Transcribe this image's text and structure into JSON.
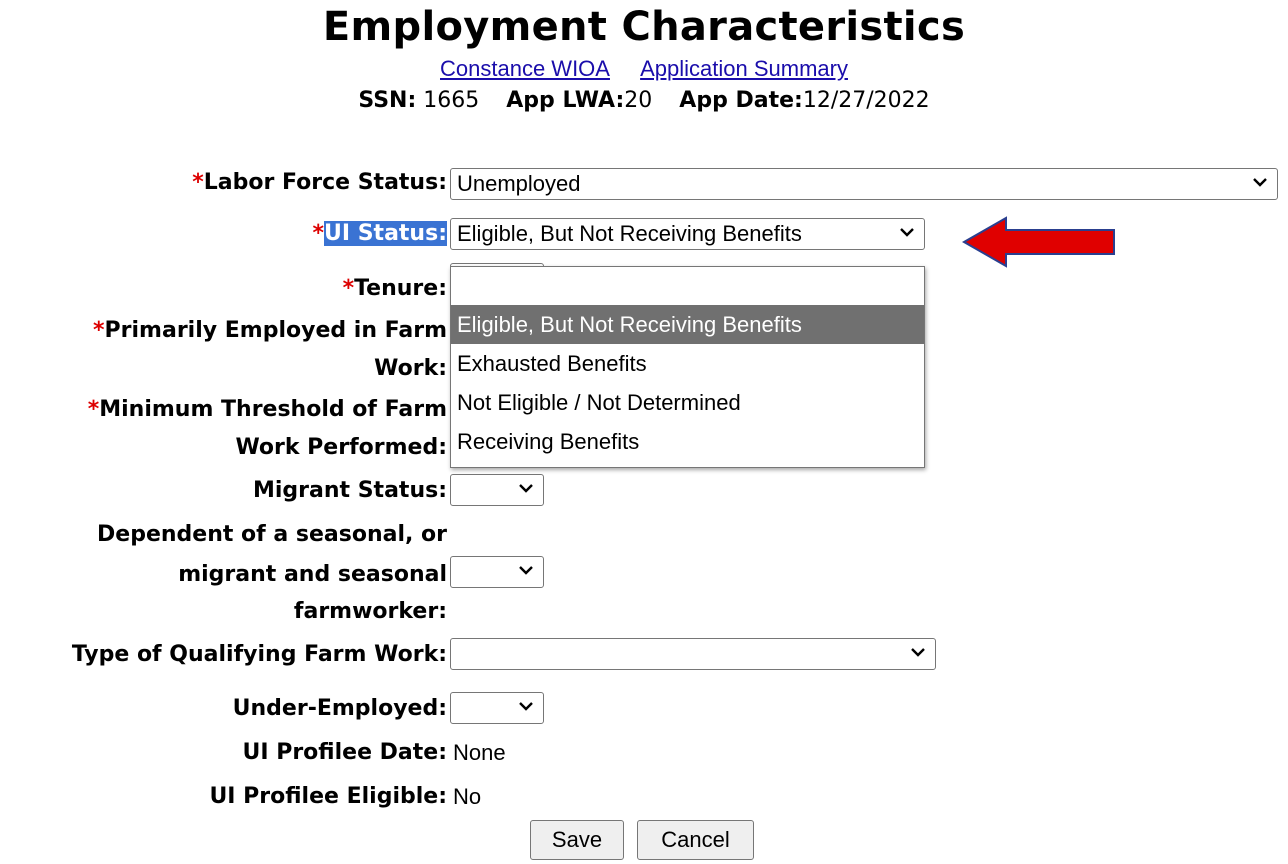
{
  "header": {
    "title": "Employment Characteristics",
    "links": {
      "applicant": "Constance WIOA",
      "summary": "Application Summary"
    },
    "meta": {
      "ssn_label": "SSN:",
      "ssn_value": "1665",
      "lwa_label": "App LWA:",
      "lwa_value": "20",
      "date_label": "App Date:",
      "date_value": "12/27/2022"
    }
  },
  "form": {
    "required_mark": "*",
    "labor_force_status": {
      "label": "Labor Force Status:",
      "value": "Unemployed"
    },
    "ui_status": {
      "label": "UI Status:",
      "value": "Eligible, But Not Receiving Benefits",
      "options": [
        "",
        "Eligible, But Not Receiving Benefits",
        "Exhausted Benefits",
        "Not Eligible / Not Determined",
        "Receiving Benefits"
      ],
      "highlighted_option": "Eligible, But Not Receiving Benefits"
    },
    "tenure": {
      "label": "Tenure:"
    },
    "primarily_employed": {
      "label_line1": "Primarily Employed in Farm",
      "label_line2": "Work:"
    },
    "minimum_threshold": {
      "label_line1": "Minimum Threshold of Farm",
      "label_line2": "Work Performed:"
    },
    "migrant_status": {
      "label": "Migrant Status:",
      "value": ""
    },
    "dependent": {
      "label_line1": "Dependent of a seasonal, or",
      "label_line2": "migrant and seasonal",
      "label_line3": "farmworker:",
      "value": ""
    },
    "type_of_farm_work": {
      "label": "Type of Qualifying Farm Work:",
      "value": ""
    },
    "under_employed": {
      "label": "Under-Employed:",
      "value": ""
    },
    "ui_profilee_date": {
      "label": "UI Profilee Date:",
      "value": "None"
    },
    "ui_profilee_eligible": {
      "label": "UI Profilee Eligible:",
      "value": "No"
    }
  },
  "buttons": {
    "save": "Save",
    "cancel": "Cancel"
  },
  "annotation": {
    "arrow_color": "#e00000",
    "arrow_outline": "#2a3f8f"
  },
  "icons": {
    "select_chevron": "chevron-down-icon",
    "annotation_arrow": "arrow-left-icon"
  }
}
